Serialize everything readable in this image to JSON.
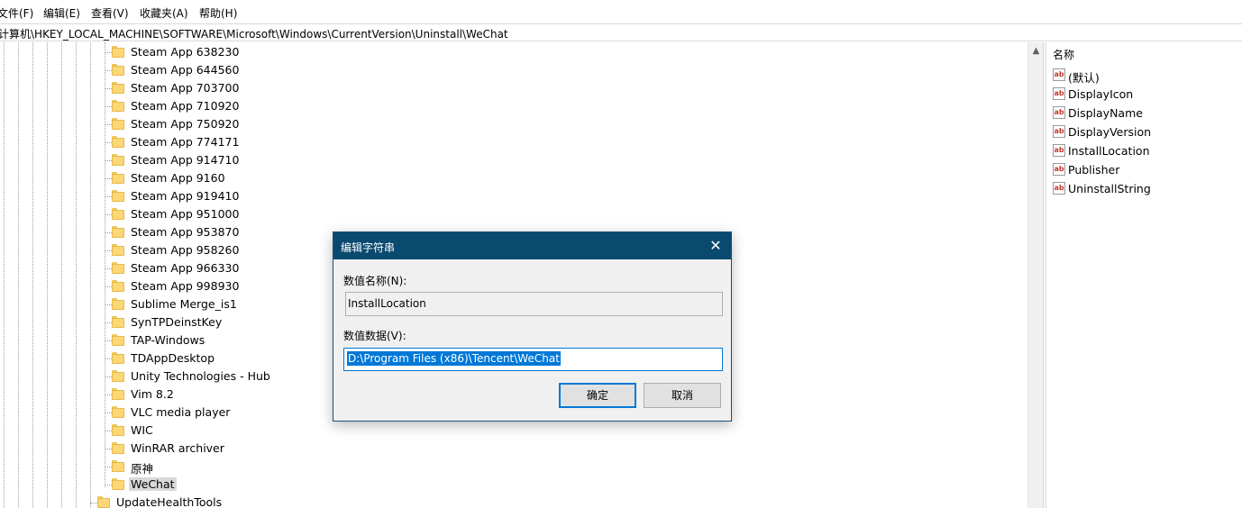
{
  "menu": {
    "items": [
      "文件(F)",
      "编辑(E)",
      "查看(V)",
      "收藏夹(A)",
      "帮助(H)"
    ]
  },
  "address": {
    "path": "计算机\\HKEY_LOCAL_MACHINE\\SOFTWARE\\Microsoft\\Windows\\CurrentVersion\\Uninstall\\WeChat"
  },
  "tree": {
    "items": [
      "Steam App 638230",
      "Steam App 644560",
      "Steam App 703700",
      "Steam App 710920",
      "Steam App 750920",
      "Steam App 774171",
      "Steam App 914710",
      "Steam App 9160",
      "Steam App 919410",
      "Steam App 951000",
      "Steam App 953870",
      "Steam App 958260",
      "Steam App 966330",
      "Steam App 998930",
      "Sublime Merge_is1",
      "SynTPDeinstKey",
      "TAP-Windows",
      "TDAppDesktop",
      "Unity Technologies - Hub",
      "Vim 8.2",
      "VLC media player",
      "WIC",
      "WinRAR archiver",
      "原神",
      "WeChat"
    ],
    "selected": "WeChat",
    "parent_sibling": "UpdateHealthTools"
  },
  "values": {
    "header": "名称",
    "items": [
      "(默认)",
      "DisplayIcon",
      "DisplayName",
      "DisplayVersion",
      "InstallLocation",
      "Publisher",
      "UninstallString"
    ],
    "type_icon_text": "ab"
  },
  "dialog": {
    "title": "编辑字符串",
    "close_glyph": "✕",
    "name_label": "数值名称(N):",
    "name_value": "InstallLocation",
    "data_label": "数值数据(V):",
    "data_value": "D:\\Program Files (x86)\\Tencent\\WeChat",
    "ok_label": "确定",
    "cancel_label": "取消"
  },
  "scrollbar": {
    "up_glyph": "▲"
  },
  "colors": {
    "dialog_titlebar": "#0b4a6f",
    "selection": "#0078d7",
    "folder": "#fbd778"
  }
}
